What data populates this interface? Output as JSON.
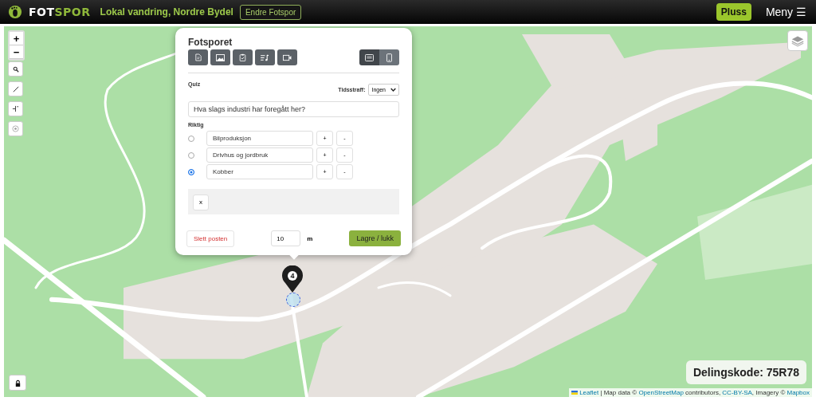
{
  "header": {
    "logo": {
      "first": "FOT",
      "second": "SPOR"
    },
    "title": "Lokal vandring, Nordre Bydel",
    "edit_button": "Endre Fotspor",
    "plus_button": "Pluss",
    "menu": {
      "label": "Meny",
      "icon": "☰"
    }
  },
  "map_controls": {
    "zoom_in": "+",
    "zoom_out": "−"
  },
  "popup": {
    "title": "Fotsporet",
    "toolbar": [
      {
        "kind": "text"
      },
      {
        "kind": "image"
      },
      {
        "kind": "checklist"
      },
      {
        "kind": "audio"
      },
      {
        "kind": "video"
      }
    ],
    "view_toggle": [
      {
        "kind": "desktop",
        "selected": true
      },
      {
        "kind": "mobile",
        "selected": false
      }
    ],
    "quiz": {
      "label": "Quiz",
      "penalty_label": "Tidsstraff:",
      "penalty_value": "Ingen",
      "question": "Hva slags industri har foregått her?",
      "correct_label": "Riktig",
      "answers": [
        {
          "text": "Bilproduksjon",
          "selected": false,
          "add": "+",
          "remove": "-"
        },
        {
          "text": "Drivhus og jordbruk",
          "selected": false,
          "add": "+",
          "remove": "-"
        },
        {
          "text": "Kobber",
          "selected": true,
          "add": "+",
          "remove": "-"
        }
      ],
      "close_button": "x"
    },
    "delete_button": "Slett posten",
    "distance": "10",
    "distance_unit": "m",
    "save_button": "Lagre / lukk"
  },
  "marker": {
    "number": "4"
  },
  "share_code": "Delingskode: 75R78",
  "attribution": [
    {
      "kind": "link",
      "text": "Leaflet"
    },
    {
      "kind": "text",
      "text": " | Map data © "
    },
    {
      "kind": "link",
      "text": "OpenStreetMap"
    },
    {
      "kind": "text",
      "text": " contributors, "
    },
    {
      "kind": "link",
      "text": "CC-BY-SA"
    },
    {
      "kind": "text",
      "text": ", Imagery © "
    },
    {
      "kind": "link",
      "text": "Mapbox"
    }
  ]
}
